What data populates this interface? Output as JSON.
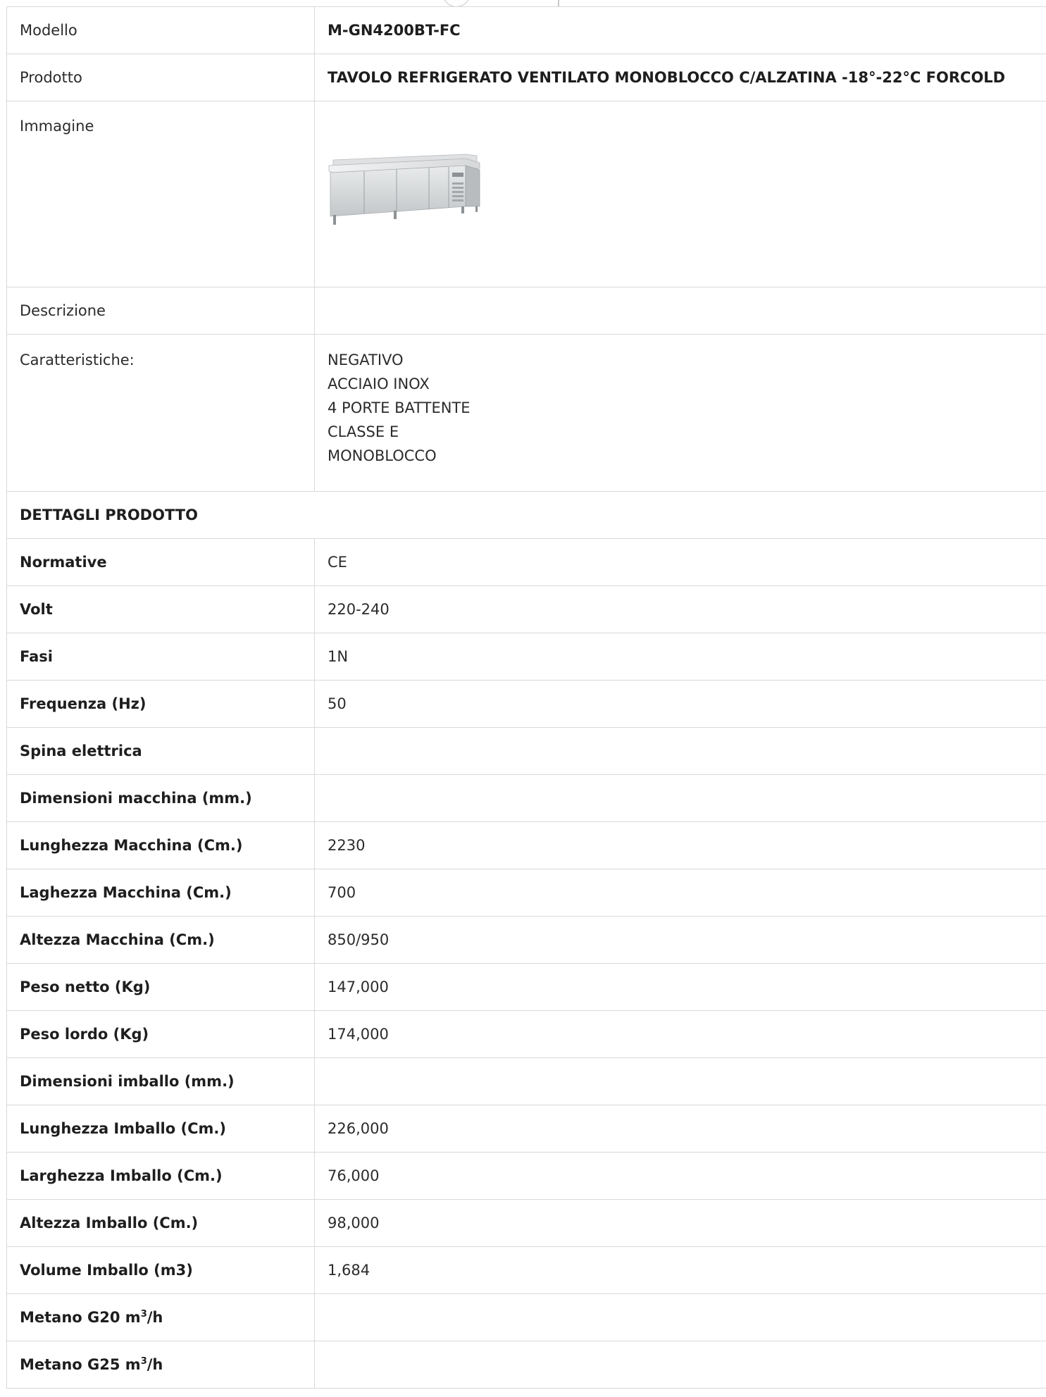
{
  "rows": {
    "modello": {
      "label": "Modello",
      "value": "M-GN4200BT-FC"
    },
    "prodotto": {
      "label": "Prodotto",
      "value": "TAVOLO REFRIGERATO VENTILATO MONOBLOCCO C/ALZATINA -18°-22°C FORCOLD"
    },
    "immagine": {
      "label": "Immagine"
    },
    "descrizione": {
      "label": "Descrizione",
      "value": ""
    },
    "caratteristiche": {
      "label": "Caratteristiche:",
      "items": [
        "NEGATIVO",
        "ACCIAIO INOX",
        "4 PORTE BATTENTE",
        "CLASSE E",
        "MONOBLOCCO"
      ]
    }
  },
  "section_title": "DETTAGLI PRODOTTO",
  "details": [
    {
      "label": "Normative",
      "value": "CE"
    },
    {
      "label": "Volt",
      "value": "220-240"
    },
    {
      "label": "Fasi",
      "value": "1N"
    },
    {
      "label": "Frequenza (Hz)",
      "value": "50"
    },
    {
      "label": "Spina elettrica",
      "value": ""
    },
    {
      "label": "Dimensioni macchina (mm.)",
      "value": ""
    },
    {
      "label": "Lunghezza Macchina (Cm.)",
      "value": "2230"
    },
    {
      "label": "Laghezza Macchina (Cm.)",
      "value": "700"
    },
    {
      "label": "Altezza Macchina (Cm.)",
      "value": "850/950"
    },
    {
      "label": "Peso netto (Kg)",
      "value": "147,000"
    },
    {
      "label": "Peso lordo (Kg)",
      "value": "174,000"
    },
    {
      "label": "Dimensioni imballo (mm.)",
      "value": ""
    },
    {
      "label": "Lunghezza Imballo (Cm.)",
      "value": "226,000"
    },
    {
      "label": "Larghezza Imballo (Cm.)",
      "value": "76,000"
    },
    {
      "label": "Altezza Imballo (Cm.)",
      "value": "98,000"
    },
    {
      "label": "Volume Imballo (m3)",
      "value": "1,684"
    }
  ],
  "gas_rows": [
    {
      "label_prefix": "Metano G20 m",
      "label_sup": "3",
      "label_suffix": "/h",
      "value": ""
    },
    {
      "label_prefix": "Metano G25 m",
      "label_sup": "3",
      "label_suffix": "/h",
      "value": ""
    }
  ],
  "image": {
    "icon": "refrigerated-counter-image"
  },
  "colors": {
    "border": "#d9d9d9",
    "text": "#2b2b2b"
  }
}
